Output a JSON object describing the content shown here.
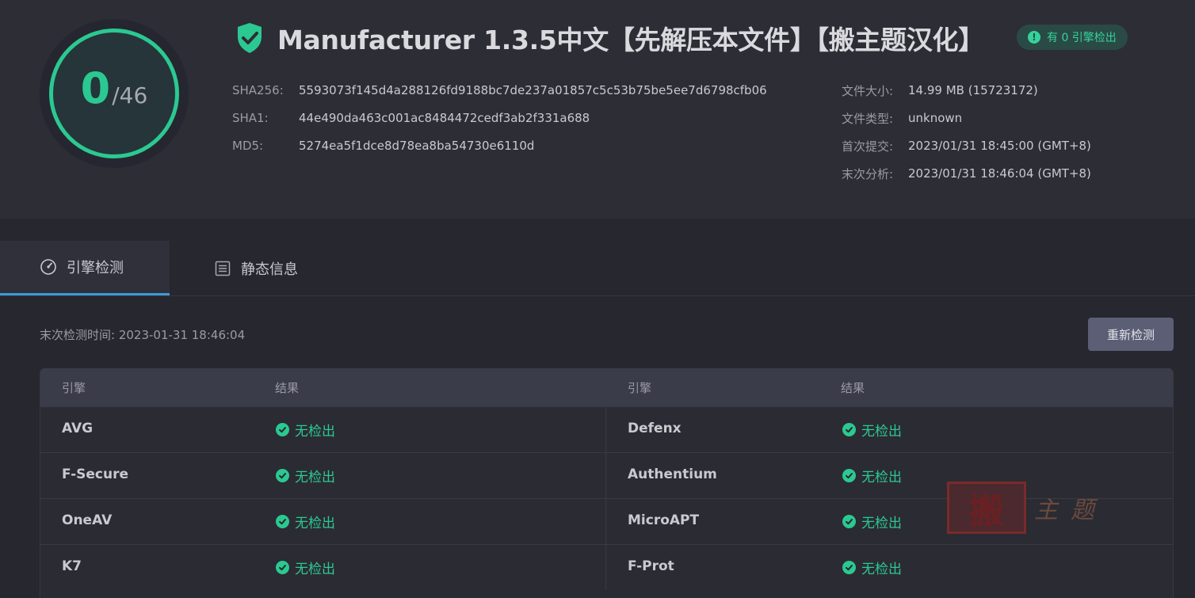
{
  "score": {
    "detected": "0",
    "total": "/46"
  },
  "header": {
    "title": "Manufacturer 1.3.5中文【先解压本文件】【搬主题汉化】",
    "badge": "有 0 引擎检出"
  },
  "hashes": [
    {
      "label": "SHA256:",
      "value": "5593073f145d4a288126fd9188bc7de237a01857c5c53b75be5ee7d6798cfb06"
    },
    {
      "label": "SHA1:",
      "value": "44e490da463c001ac8484472cedf3ab2f331a688"
    },
    {
      "label": "MD5:",
      "value": "5274ea5f1dce8d78ea8ba54730e6110d"
    }
  ],
  "info": [
    {
      "label": "文件大小:",
      "value": "14.99 MB (15723172)"
    },
    {
      "label": "文件类型:",
      "value": "unknown"
    },
    {
      "label": "首次提交:",
      "value": "2023/01/31 18:45:00 (GMT+8)"
    },
    {
      "label": "末次分析:",
      "value": "2023/01/31 18:46:04 (GMT+8)"
    }
  ],
  "tabs": [
    {
      "label": "引擎检测",
      "active": true
    },
    {
      "label": "静态信息",
      "active": false
    }
  ],
  "scan": {
    "last_scan": "末次检测时间: 2023-01-31 18:46:04",
    "rescan_label": "重新检测"
  },
  "table": {
    "headers": [
      "引擎",
      "结果",
      "引擎",
      "结果"
    ],
    "rows": [
      {
        "left_engine": "AVG",
        "left_result": "无检出",
        "right_engine": "Defenx",
        "right_result": "无检出"
      },
      {
        "left_engine": "F-Secure",
        "left_result": "无检出",
        "right_engine": "Authentium",
        "right_result": "无检出"
      },
      {
        "left_engine": "OneAV",
        "left_result": "无检出",
        "right_engine": "MicroAPT",
        "right_result": "无检出"
      },
      {
        "left_engine": "K7",
        "left_result": "无检出",
        "right_engine": "F-Prot",
        "right_result": "无检出"
      }
    ]
  },
  "watermark": {
    "seal": "搬",
    "text": "主题"
  },
  "colors": {
    "accent_green": "#2bc991",
    "tab_active": "#3a9bd8",
    "background": "#27272f"
  }
}
